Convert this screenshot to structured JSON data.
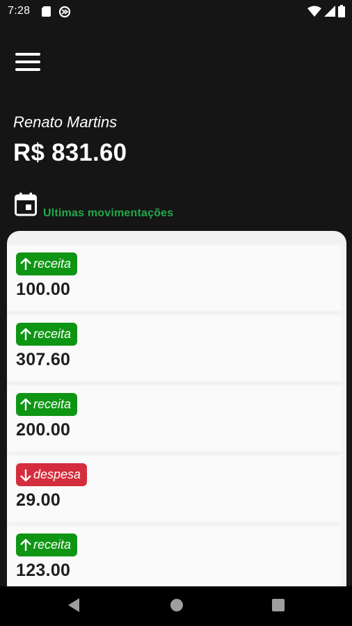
{
  "status_bar": {
    "time": "7:28",
    "icons": [
      "sd-card-icon",
      "sync-icon",
      "wifi-icon",
      "signal-icon",
      "battery-icon"
    ]
  },
  "header": {
    "menu_icon": "hamburger-menu-icon",
    "user_name": "Renato Martins",
    "balance": "R$ 831.60"
  },
  "section": {
    "icon": "calendar-icon",
    "title": "Ultimas movimentações"
  },
  "transactions": [
    {
      "type": "receita",
      "direction": "up",
      "label": "receita",
      "amount": "100.00"
    },
    {
      "type": "receita",
      "direction": "up",
      "label": "receita",
      "amount": "307.60"
    },
    {
      "type": "receita",
      "direction": "up",
      "label": "receita",
      "amount": "200.00"
    },
    {
      "type": "despesa",
      "direction": "down",
      "label": "despesa",
      "amount": "29.00"
    },
    {
      "type": "receita",
      "direction": "up",
      "label": "receita",
      "amount": "123.00"
    }
  ],
  "colors": {
    "background": "#151515",
    "accent_green": "#22a94b",
    "receita_badge": "#0f9514",
    "despesa_badge": "#d42d3d",
    "card": "#f2f2f2"
  },
  "nav_bar": {
    "icons": [
      "back-icon",
      "home-icon",
      "recents-icon"
    ]
  }
}
